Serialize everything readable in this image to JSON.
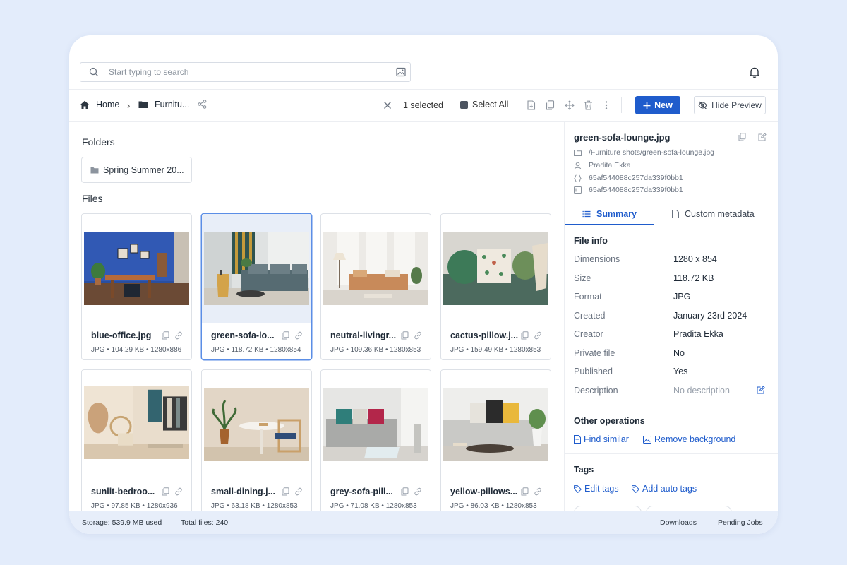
{
  "search": {
    "placeholder": "Start typing to search"
  },
  "breadcrumb": {
    "home": "Home",
    "folder": "Furnitu..."
  },
  "toolbar": {
    "selected": "1 selected",
    "select_all": "Select All",
    "new_label": "New",
    "hide_preview": "Hide Preview"
  },
  "folders": {
    "title": "Folders",
    "items": [
      {
        "name": "Spring Summer 20..."
      }
    ]
  },
  "files": {
    "title": "Files",
    "items": [
      {
        "name": "blue-office.jpg",
        "meta": "JPG • 104.29 KB • 1280x886"
      },
      {
        "name": "green-sofa-lo...",
        "meta": "JPG • 118.72 KB • 1280x854"
      },
      {
        "name": "neutral-livingr...",
        "meta": "JPG • 109.36 KB • 1280x853"
      },
      {
        "name": "cactus-pillow.j...",
        "meta": "JPG • 159.49 KB • 1280x853"
      },
      {
        "name": "sunlit-bedroo...",
        "meta": "JPG • 97.85 KB • 1280x936"
      },
      {
        "name": "small-dining.j...",
        "meta": "JPG • 63.18 KB • 1280x853"
      },
      {
        "name": "grey-sofa-pill...",
        "meta": "JPG • 71.08 KB • 1280x853"
      },
      {
        "name": "yellow-pillows...",
        "meta": "JPG • 86.03 KB • 1280x853"
      }
    ]
  },
  "preview": {
    "title": "green-sofa-lounge.jpg",
    "path": "/Furniture shots/green-sofa-lounge.jpg",
    "owner": "Pradita Ekka",
    "id": "65af544088c257da339f0bb1",
    "id2": "65af544088c257da339f0bb1",
    "tabs": {
      "summary": "Summary",
      "custom": "Custom metadata"
    },
    "file_info": {
      "title": "File info",
      "rows": [
        {
          "k": "Dimensions",
          "v": "1280 x 854"
        },
        {
          "k": "Size",
          "v": "118.72 KB"
        },
        {
          "k": "Format",
          "v": "JPG"
        },
        {
          "k": "Created",
          "v": "January 23rd 2024"
        },
        {
          "k": "Creator",
          "v": "Pradita Ekka"
        },
        {
          "k": "Private file",
          "v": "No"
        },
        {
          "k": "Published",
          "v": "Yes"
        },
        {
          "k": "Description",
          "v": "No description"
        }
      ]
    },
    "other_ops": {
      "title": "Other operations",
      "find_similar": "Find similar",
      "remove_bg": "Remove background"
    },
    "tags": {
      "title": "Tags",
      "edit": "Edit tags",
      "auto": "Add auto tags"
    }
  },
  "footer": {
    "storage": "Storage: 539.9 MB used",
    "total": "Total files: 240",
    "downloads": "Downloads",
    "pending": "Pending Jobs"
  },
  "colors": {
    "accent": "#1f5ccc",
    "background": "#e3ecfb",
    "footer": "#e7eefa"
  }
}
